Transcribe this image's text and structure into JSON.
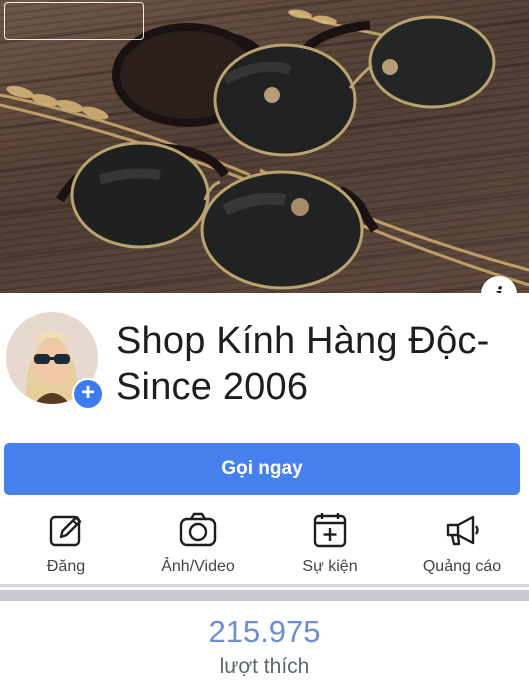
{
  "page": {
    "name": "Shop Kính Hàng Độc-Since 2006",
    "call_button_label": "Gọi ngay",
    "info_label": "i",
    "add_symbol": "+"
  },
  "actions": [
    {
      "label": "Đăng",
      "icon": "edit-icon"
    },
    {
      "label": "Ảnh/Video",
      "icon": "camera-icon"
    },
    {
      "label": "Sự kiện",
      "icon": "calendar-plus-icon"
    },
    {
      "label": "Quảng cáo",
      "icon": "megaphone-icon"
    }
  ],
  "stats": {
    "likes_count": "215.975",
    "likes_label": "lượt thích"
  },
  "colors": {
    "accent": "#4781f0",
    "likes_text": "#6a8fd6"
  }
}
